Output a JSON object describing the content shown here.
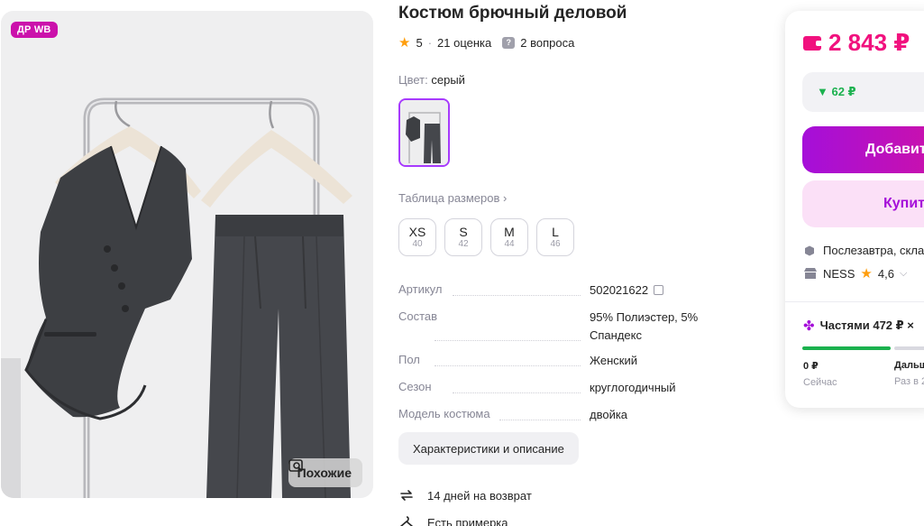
{
  "product": {
    "title": "Костюм брючный деловой",
    "badge": "ДР WB",
    "similar_label": "Похожие",
    "rating": "5",
    "reviews": "21 оценка",
    "questions": "2 вопроса",
    "color_label": "Цвет:",
    "color_value": "серый",
    "size_table_label": "Таблица размеров ›",
    "sizes": [
      {
        "label": "XS",
        "ru": "40"
      },
      {
        "label": "S",
        "ru": "42"
      },
      {
        "label": "M",
        "ru": "44"
      },
      {
        "label": "L",
        "ru": "46"
      }
    ],
    "specs": [
      {
        "key": "Артикул",
        "value": "502021622"
      },
      {
        "key": "Состав",
        "value": "95% Полиэстер, 5% Спандекс"
      },
      {
        "key": "Пол",
        "value": "Женский"
      },
      {
        "key": "Сезон",
        "value": "круглогодичный"
      },
      {
        "key": "Модель костюма",
        "value": "двойка"
      }
    ],
    "desc_button": "Характеристики и описание",
    "features": [
      "14 дней на возврат",
      "Есть примерка"
    ]
  },
  "buy_card": {
    "price": "2 843 ₽",
    "discount": "▼ 62 ₽",
    "add_label": "Добавить",
    "buy_label": "Купить",
    "delivery": "Послезавтра, склад",
    "seller_name": "NESS",
    "seller_rating": "4,6",
    "installments": "Частями 472 ₽ ×",
    "pay_now_amount": "0 ₽",
    "pay_now_label": "Сейчас",
    "pay_later_amount": "Дальше",
    "pay_later_label": "Раз в 2"
  },
  "colors": {
    "accent": "#a50fd9",
    "price": "#f1117e",
    "badge": "#cb11ab",
    "discount": "#1bb14e"
  }
}
